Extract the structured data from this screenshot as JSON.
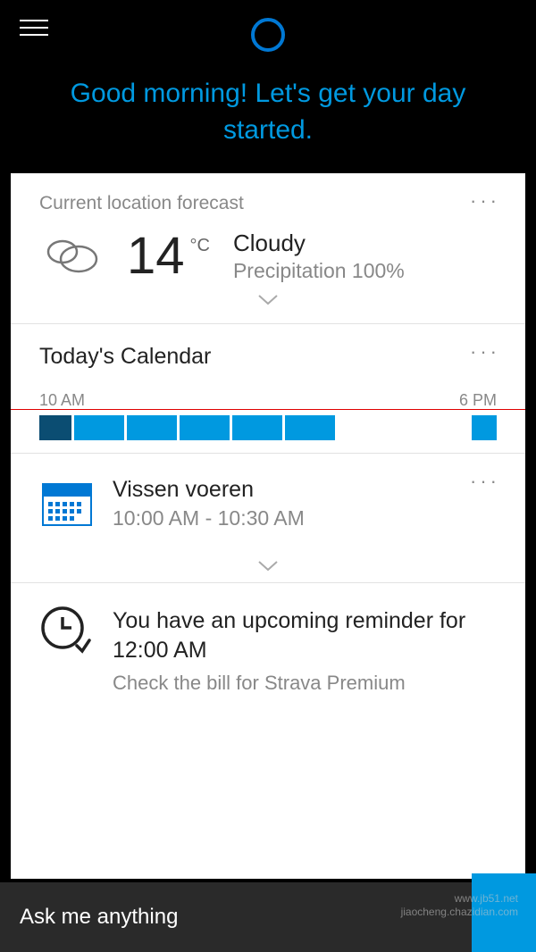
{
  "greeting": "Good morning! Let's get your day started.",
  "weather": {
    "header": "Current location forecast",
    "temp": "14",
    "unit": "°C",
    "condition": "Cloudy",
    "precip": "Precipitation 100%"
  },
  "calendar": {
    "title": "Today's Calendar",
    "start": "10 AM",
    "end": "6 PM"
  },
  "event": {
    "title": "Vissen voeren",
    "time": "10:00 AM - 10:30 AM"
  },
  "reminder": {
    "title": "You have an upcoming reminder for 12:00 AM",
    "sub": "Check the bill for Strava Premium"
  },
  "bottom": {
    "placeholder": "Ask me anything"
  },
  "watermark": {
    "line1": "www.jb51.net",
    "line2": "jiaocheng.chazidian.com"
  }
}
